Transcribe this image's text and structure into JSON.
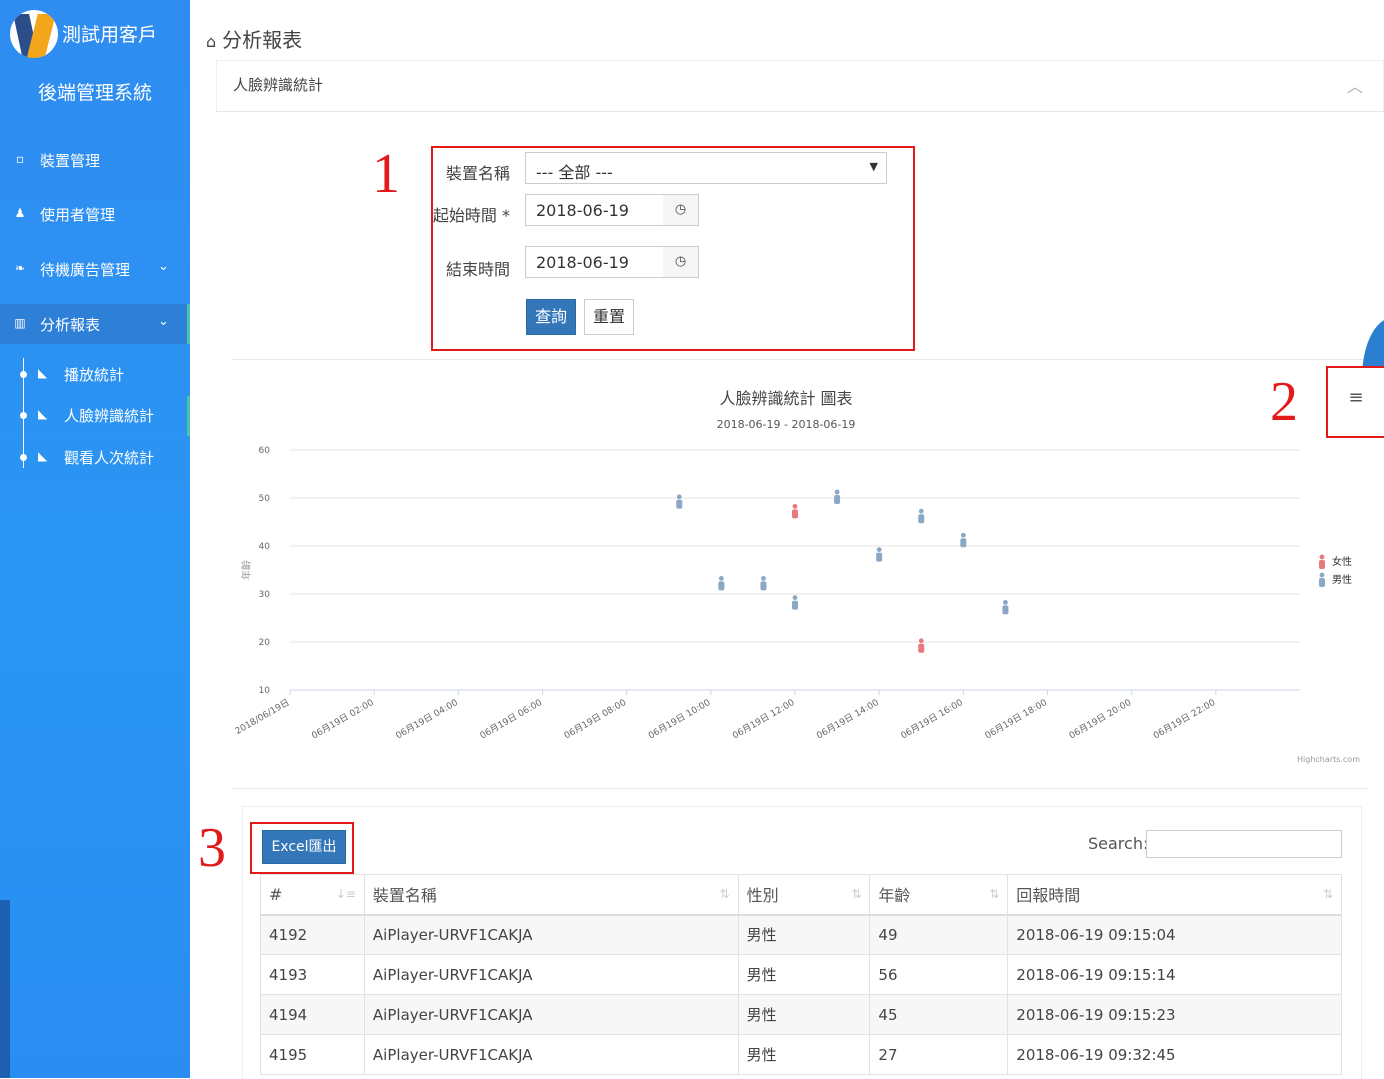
{
  "sidebar": {
    "brand": "測試用客戶",
    "subtitle": "後端管理系統",
    "items": [
      {
        "icon": "square-icon",
        "label": "裝置管理"
      },
      {
        "icon": "user-icon",
        "label": "使用者管理"
      },
      {
        "icon": "leaf-icon",
        "label": "待機廣告管理"
      },
      {
        "icon": "bar-chart-icon",
        "label": "分析報表"
      }
    ],
    "subitems": [
      {
        "icon": "area-chart-icon",
        "label": "播放統計"
      },
      {
        "icon": "area-chart-icon",
        "label": "人臉辨識統計"
      },
      {
        "icon": "area-chart-icon",
        "label": "觀看人次統計"
      }
    ]
  },
  "breadcrumb": {
    "title": "分析報表"
  },
  "panel": {
    "title": "人臉辨識統計"
  },
  "annotations": {
    "one": "1",
    "two": "2",
    "three": "3"
  },
  "form": {
    "device_label": "裝置名稱",
    "device_value": "--- 全部 ---",
    "start_label": "起始時間 *",
    "start_value": "2018-06-19",
    "end_label": "結束時間",
    "end_value": "2018-06-19",
    "query_button": "查詢",
    "reset_button": "重置"
  },
  "chart_data": {
    "type": "scatter",
    "title": "人臉辨識統計 圖表",
    "subtitle": "2018-06-19 - 2018-06-19",
    "ylabel": "年齡",
    "ylim": [
      10,
      60
    ],
    "yticks": [
      10,
      20,
      30,
      40,
      50,
      60
    ],
    "xlim_hours": [
      0,
      24
    ],
    "xticks": [
      "2018/06/19日",
      "06月19日 02:00",
      "06月19日 04:00",
      "06月19日 06:00",
      "06月19日 08:00",
      "06月19日 10:00",
      "06月19日 12:00",
      "06月19日 14:00",
      "06月19日 16:00",
      "06月19日 18:00",
      "06月19日 20:00",
      "06月19日 22:00"
    ],
    "credit": "Highcharts.com",
    "legend_position": "right",
    "series": [
      {
        "name": "女性",
        "color": "#e8797f",
        "points": [
          {
            "x": "12:00",
            "y": 47
          },
          {
            "x": "15:00",
            "y": 19
          }
        ]
      },
      {
        "name": "男性",
        "color": "#8aa7c6",
        "points": [
          {
            "x": "09:15",
            "y": 49
          },
          {
            "x": "10:15",
            "y": 32
          },
          {
            "x": "11:15",
            "y": 32
          },
          {
            "x": "12:00",
            "y": 28
          },
          {
            "x": "13:00",
            "y": 50
          },
          {
            "x": "14:00",
            "y": 38
          },
          {
            "x": "15:00",
            "y": 46
          },
          {
            "x": "16:00",
            "y": 41
          },
          {
            "x": "17:00",
            "y": 27
          }
        ]
      }
    ]
  },
  "table": {
    "export_button": "Excel匯出",
    "search_label": "Search:",
    "columns": [
      "#",
      "裝置名稱",
      "性別",
      "年齡",
      "回報時間"
    ],
    "rows": [
      [
        "4192",
        "AiPlayer-URVF1CAKJA",
        "男性",
        "49",
        "2018-06-19 09:15:04"
      ],
      [
        "4193",
        "AiPlayer-URVF1CAKJA",
        "男性",
        "56",
        "2018-06-19 09:15:14"
      ],
      [
        "4194",
        "AiPlayer-URVF1CAKJA",
        "男性",
        "45",
        "2018-06-19 09:15:23"
      ],
      [
        "4195",
        "AiPlayer-URVF1CAKJA",
        "男性",
        "27",
        "2018-06-19 09:32:45"
      ]
    ]
  }
}
